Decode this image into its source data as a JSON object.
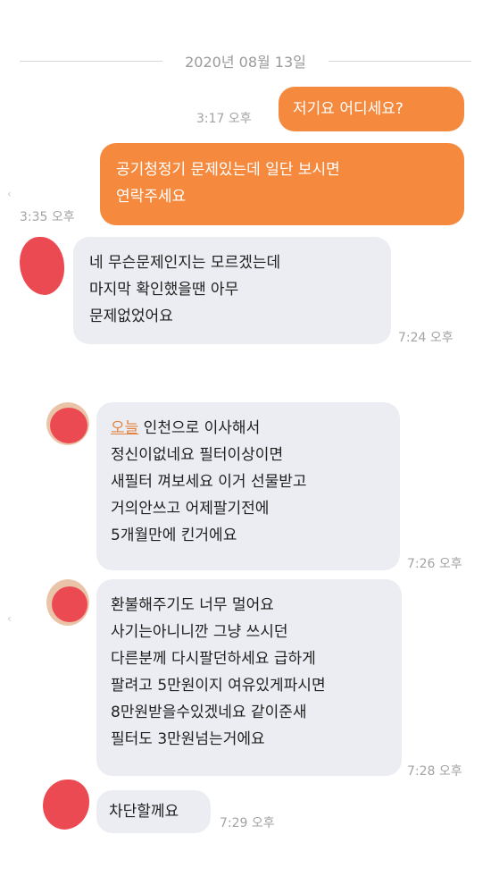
{
  "date_separator": "2020년 08월 13일",
  "messages": [
    {
      "type": "sent",
      "text": "저기요  어디세요?",
      "time": "3:17 오후"
    },
    {
      "type": "sent",
      "lines": [
        "공기청정기 문제있는데  일단 보시면",
        "연락주세요"
      ],
      "time": "3:35 오후"
    },
    {
      "type": "received",
      "lines": [
        "네 무슨문제인지는 모르겠는데",
        "마지막 확인했을땐 아무",
        "문제없었어요"
      ],
      "time": "7:24 오후"
    },
    {
      "type": "received",
      "highlight": "오늘",
      "lines": [
        " 인천으로 이사해서",
        "정신이없네요   필터이상이면",
        "새필터 껴보세요 이거 선물받고",
        "거의안쓰고 어제팔기전에",
        "5개월만에 킨거에요"
      ],
      "time": "7:26 오후"
    },
    {
      "type": "received",
      "lines": [
        "환불해주기도 너무 멀어요",
        "사기는아니니깐  그냥 쓰시던",
        "다른분께 다시팔던하세요  급하게",
        "팔려고 5만원이지 여유있게파시면",
        "8만원받을수있겠네요 같이준새",
        "필터도 3만원넘는거에요"
      ],
      "time": "7:28 오후"
    },
    {
      "type": "received",
      "text": "차단할께요",
      "time": "7:29 오후"
    }
  ],
  "colors": {
    "sent_bubble": "#f58a3f",
    "received_bubble": "#ecedf2",
    "link_orange": "#e2823f"
  }
}
